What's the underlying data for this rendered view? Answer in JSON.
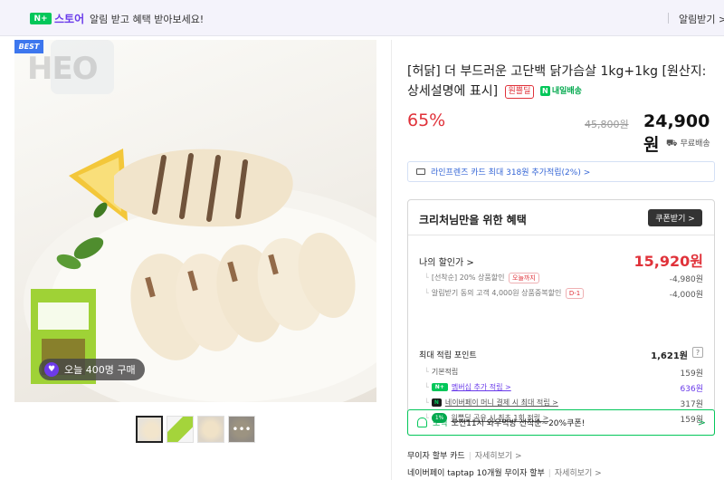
{
  "banner": {
    "np_logo": "N+",
    "store_label": "스토어",
    "text": "알림 받고 혜택 받아보세요!",
    "alert_button": "알림받기 >"
  },
  "gallery": {
    "best_badge": "BEST",
    "brand_watermark": "HEO",
    "today_icon": "♥",
    "today_purchase": "오늘 400명 구매",
    "thumb_count": 4,
    "more_glyph": "•••"
  },
  "product": {
    "title": "[허닭] 더 부드러운 고단백 닭가슴살 1kg+1kg [원산지:상세설명에 표시]",
    "badge_wonder": "원쁠딜",
    "badge_tomorrow": "내일배송",
    "discount_rate": "65%",
    "original_price": "45,800원",
    "sale_price": "24,900원",
    "shipping": "무료배송"
  },
  "card_promo": "라인프렌즈 카드 최대 318원 추가적립(2%) >",
  "benefits": {
    "title": "크리처님만을 위한 혜택",
    "coupon_button": "쿠폰받기 >",
    "my_discount_label": "나의 할인가 >",
    "my_discount_price": "15,920원",
    "discounts": [
      {
        "label": "[선착순] 20% 상품할인",
        "tag": "오늘까지",
        "value": "-4,980원"
      },
      {
        "label": "알림받기 동의 고객 4,000원 상품중복할인",
        "tag": "D-1",
        "value": "-4,000원"
      }
    ],
    "points_label": "최대 적립 포인트",
    "points_value": "1,621원",
    "points_help": "?",
    "points": [
      {
        "label": "기본적립",
        "value": "159원",
        "kind": "plain"
      },
      {
        "label": "멤버십 추가 적립 >",
        "value": "636원",
        "kind": "membership"
      },
      {
        "label": "네이버페이 머니 결제 시 최대 적립 >",
        "value": "317원",
        "kind": "npay"
      },
      {
        "label": "원쁠딜 공유 시 최초 1회 적립 >",
        "value": "159원",
        "kind": "share",
        "pct": "1%"
      }
    ]
  },
  "promo": {
    "prefix": "소식",
    "text": "오전11시 와우먹방 선착순~20%쿠폰!",
    "chevron": ">"
  },
  "payments": [
    {
      "label": "무이자 할부 카드",
      "more": "자세히보기 >"
    },
    {
      "label": "네이버페이 taptap 10개월 무이자 할부",
      "more": "자세히보기 >"
    }
  ],
  "colors": {
    "naver_green": "#03c75a",
    "store_purple": "#6a3bea",
    "sale_red": "#e0323a",
    "card_blue": "#3566d6"
  }
}
